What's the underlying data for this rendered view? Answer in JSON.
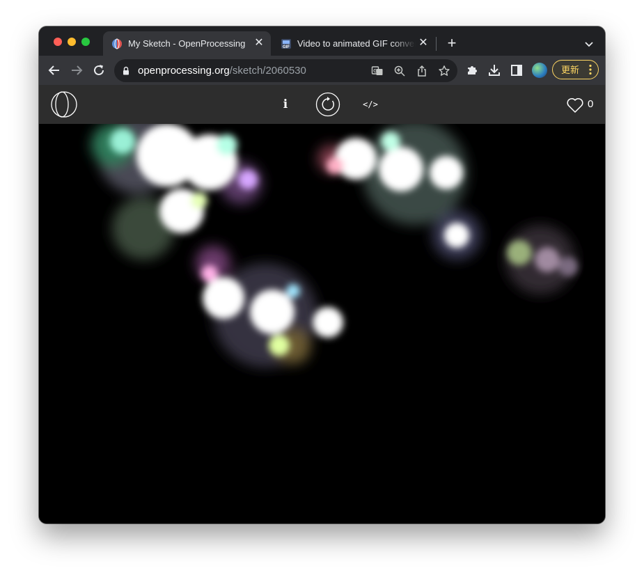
{
  "browser": {
    "tabs": [
      {
        "title": "My Sketch - OpenProcessing",
        "active": true
      },
      {
        "title": "Video to animated GIF converter",
        "active": false
      }
    ],
    "address_bar": {
      "domain": "openprocessing.org",
      "path": "/sketch/2060530"
    },
    "update_button_label": "更新",
    "icons": {
      "back": "back-arrow-icon",
      "forward": "forward-arrow-icon",
      "reload": "reload-icon",
      "lock": "lock-icon",
      "translate": "translate-icon",
      "zoom": "zoom-icon",
      "share": "share-icon",
      "bookmark": "star-icon",
      "extensions": "puzzle-icon",
      "downloads": "download-icon",
      "side_panel": "side-panel-icon",
      "menu": "kebab-menu-icon"
    }
  },
  "openprocessing": {
    "info_label": "i",
    "code_label": "</>",
    "like_count": "0"
  },
  "colors": {
    "tabstrip": "#202124",
    "toolbar": "#35363a",
    "omnibox": "#202124",
    "page_header": "#2d2d2d",
    "canvas": "#000000",
    "update_accent": "#fdd663"
  }
}
